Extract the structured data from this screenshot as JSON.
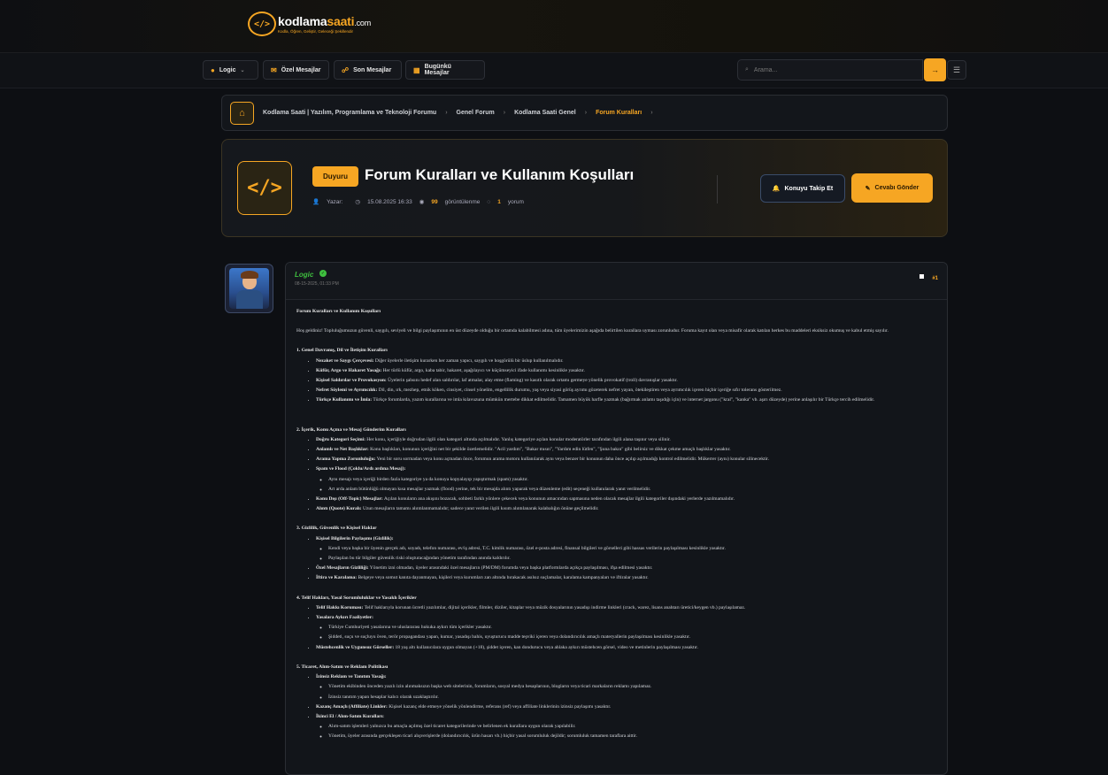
{
  "logo": {
    "main_a": "kodlama",
    "main_b": "saati",
    ".com": ".com",
    "suffix": ".com",
    "tagline": "Kodla, Öğren, Geliştir, Geleceği Şekillendir",
    "mark": "</>"
  },
  "nav": {
    "user": "Logic",
    "pm": "Özel Mesajlar",
    "recent": "Son Mesajlar",
    "today": "Bugünkü Mesajlar",
    "search_placeholder": "Arama..."
  },
  "breadcrumb": [
    "Kodlama Saati | Yazılım, Programlama ve Teknoloji Forumu",
    "Genel Forum",
    "Kodlama Saati Genel",
    "Forum Kuralları"
  ],
  "thread": {
    "badge": "Duyuru",
    "title": "Forum Kuralları ve Kullanım Koşulları",
    "author_label": "Yazar:",
    "date": "15.08.2025 16:33",
    "views": "99",
    "views_label": "görüntülenme",
    "comments": "1",
    "comments_label": "yorum",
    "follow": "Konuyu Takip Et",
    "reply": "Cevabı Gönder",
    "icon": "</>"
  },
  "post": {
    "username": "Logic",
    "time": "08-15-2025, 01:33 PM",
    "number": "#1",
    "heading": "Forum Kuralları ve Kullanım Koşulları",
    "intro": "Hoş geldiniz! Topluluğumuzun güvenli, saygılı, seviyeli ve bilgi paylaşımının en üst düzeyde olduğu bir ortamda kalabilmesi adına, tüm üyelerimizin aşağıda belirtilen kurallara uyması zorunludur. Foruma kayıt olan veya misafir olarak katılan herkes bu maddeleri eksiksiz okumuş ve kabul etmiş sayılır.",
    "s1": "1. Genel Davranış, Dil ve İletişim Kuralları",
    "s1a_b": "Nezaket ve Saygı Çerçevesi:",
    "s1a": "Diğer üyelerle iletişim kurarken her zaman yapıcı, saygılı ve hoşgörülü bir üslup kullanılmalıdır.",
    "s1b_b": "Küfür, Argo ve Hakaret Yasağı:",
    "s1b": "Her türlü küfür, argo, kaba tabir, hakaret, aşağılayıcı ve küçümseyici ifade kullanımı kesinlikle yasaktır.",
    "s1c_b": "Kişisel Saldırılar ve Provokasyon:",
    "s1c": "Üyelerin şahsını hedef alan saldırılar, laf atmalar, alay etme (flaming) ve kasıtlı olarak ortamı germeye yönelik provokatif (troll) davranışlar yasaktır.",
    "s1d_b": "Nefret Söylemi ve Ayrımcılık:",
    "s1d": "Dil, din, ırk, mezhep, etnik köken, cinsiyet, cinsel yönelim, engellilik durumu, yaş veya siyasi görüş ayrımı gözeterek nefret yayan, ötekileştiren veya ayrımcılık içeren hiçbir içeriğe sıfır tolerans gösterilmez.",
    "s1e_b": "Türkçe Kullanımı ve İmla:",
    "s1e": "Türkçe forumlarda, yazım kurallarına ve imla kılavuzuna mümkün mertebe dikkat edilmelidir. Tamamen büyük harfle yazmak (bağırmak anlamı taşıdığı için) ve internet jargonu (\"kral\", \"kanka\" vb. aşırı düzeyde) yerine anlaşılır bir Türkçe tercih edilmelidir.",
    "s2": "2. İçerik, Konu Açma ve Mesaj Gönderim Kuralları",
    "s2a_b": "Doğru Kategori Seçimi:",
    "s2a": "Her konu, içeriğiyle doğrudan ilgili olan kategori altında açılmalıdır. Yanlış kategoriye açılan konular moderatörler tarafından ilgili alana taşınır veya silinir.",
    "s2b_b": "Anlamlı ve Net Başlıklar:",
    "s2b": "Konu başlıkları, konunun içeriğini net bir şekilde özetlemelidir. \"Acil yardım\", \"Bakar mısın\", \"Yardım edin lütfen\", \"Şuna bakın\" gibi belirsiz ve dikkat çekme amaçlı başlıklar yasaktır.",
    "s2c_b": "Arama Yapma Zorunluluğu:",
    "s2c": "Yeni bir soru sormadan veya konu açmadan önce, forumun arama motoru kullanılarak aynı veya benzer bir konunun daha önce açılıp açılmadığı kontrol edilmelidir. Mükerrer (aynı) konular silinecektir.",
    "s2d_b": "Spam ve Flood (Çoklu/Ardı ardına Mesaj):",
    "s2d1": "Aynı mesajı veya içeriği birden fazla kategoriye ya da konuya kopyalayıp yapıştırmak (spam) yasaktır.",
    "s2d2": "Art arda anlam bütünlüğü olmayan kısa mesajlar yazmak (flood) yerine, tek bir mesajda alıntı yaparak veya düzenleme (edit) seçeneği kullanılarak yanıt verilmelidir.",
    "s2e_b": "Konu Dışı (Off-Topic) Mesajlar:",
    "s2e": "Açılan konuların ana akışını bozacak, sohbeti farklı yönlere çekecek veya konunun amacından sapmasına neden olacak mesajlar ilgili kategoriler dışındaki yerlerde yazılmamalıdır.",
    "s2f_b": "Alıntı (Quote) Kuralı:",
    "s2f": "Uzun mesajların tamamı alıntılanmamalıdır; sadece yanıt verilen ilgili kısım alıntılanarak kalabalığın önüne geçilmelidir.",
    "s3": "3. Gizlilik, Güvenlik ve Kişisel Haklar",
    "s3a_b": "Kişisel Bilgilerin Paylaşımı (Gizlilik):",
    "s3a1": "Kendi veya başka bir üyenin gerçek adı, soyadı, telefon numarası, ev/iş adresi, T.C. kimlik numarası, özel e-posta adresi, finansal bilgileri ve görselleri gibi hassas verilerin paylaşılması kesinlikle yasaktır.",
    "s3a2": "Paylaşılan bu tür bilgiler güvenlik riski oluşturacağından yönetim tarafından anında kaldırılır.",
    "s3b_b": "Özel Mesajların Gizliliği:",
    "s3b": "Yönetim izni olmadan, üyeler arasındaki özel mesajların (PM/DM) forumda veya başka platformlarda açıkça paylaşılması, ifşa edilmesi yasaktır.",
    "s3c_b": "İftira ve Karalama:",
    "s3c": "Belgeye veya somut kanıta dayanmayan, kişileri veya kurumları zan altında bırakacak asılsız suçlamalar, karalama kampanyaları ve iftiralar yasaktır.",
    "s4": "4. Telif Hakları, Yasal Sorumluluklar ve Yasaklı İçerikler",
    "s4a_b": "Telif Hakkı Koruması:",
    "s4a": "Telif haklarıyla korunan ücretli yazılımlar, dijital içerikler, filmler, diziler, kitaplar veya müzik dosyalarının yasadışı indirme linkleri (crack, warez, lisans anahtarı üretici/keygen vb.) paylaşılamaz.",
    "s4b_b": "Yasalara Aykırı Faaliyetler:",
    "s4b1": "Türkiye Cumhuriyeti yasalarına ve uluslararası hukuka aykırı tüm içerikler yasaktır.",
    "s4b2": "Şiddeti, suçu ve suçluyu öven, terör propagandası yapan, kumar, yasadışı bahis, uyuşturucu madde teşviki içeren veya dolandırıcılık amaçlı materyallerin paylaşılması kesinlikle yasaktır.",
    "s4c_b": "Müstehcenlik ve Uygunsuz Görseller:",
    "s4c": "18 yaş altı kullanıcılara uygun olmayan (+18), şiddet içeren, kan dondurucu veya ahlaka aykırı müstehcen görsel, video ve metinlerin paylaşılması yasaktır.",
    "s5": "5. Ticaret, Alım-Satım ve Reklam Politikası",
    "s5a_b": "İzinsiz Reklam ve Tanıtım Yasağı:",
    "s5a1": "Yönetim ekibinden önceden yazılı izin alınmaksızın başka web sitelerinin, forumların, sosyal medya hesaplarının, blogların veya ticari markaların reklamı yapılamaz.",
    "s5a2": "İzinsiz tanıtım yapan hesaplar kalıcı olarak uzaklaştırılır.",
    "s5b_b": "Kazanç Amaçlı (Affiliate) Linkler:",
    "s5b": "Kişisel kazanç elde etmeye yönelik yönlendirme, referans (ref) veya affiliate linklerinin izinsiz paylaşımı yasaktır.",
    "s5c_b": "İkinci El / Alım-Satım Kuralları:",
    "s5c1": "Alım-satım işlemleri yalnızca bu amaçla açılmış özel ticaret kategorilerinde ve belirlenen ek kurallara uygun olarak yapılabilir.",
    "s5c2": "Yönetim, üyeler arasında gerçekleşen ticari alışverişlerde (dolandırıcılık, ürün hasarı vb.) hiçbir yasal sorumluluk dejildir; sorumluluk tamamen taraflara aittir."
  }
}
